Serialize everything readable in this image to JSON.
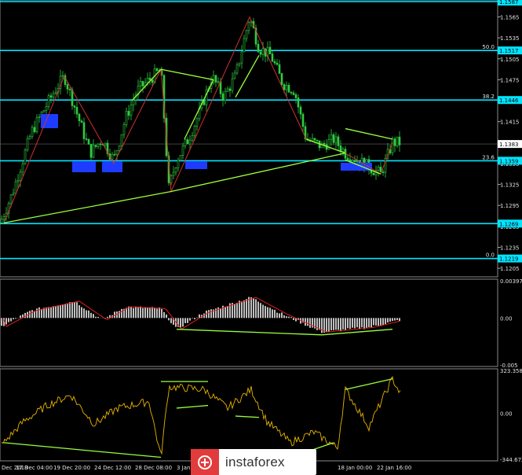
{
  "chart_data": {
    "type": "candlestick",
    "panels": [
      {
        "name": "price",
        "y_ticks": [
          "1.1565",
          "1.1535",
          "1.1505",
          "1.1475",
          "1.1445",
          "1.1415",
          "1.1383",
          "1.1355",
          "1.1325",
          "1.1295",
          "1.1265",
          "1.1235",
          "1.1205"
        ],
        "ylim": [
          1.1195,
          1.1587
        ],
        "fib_levels": [
          {
            "pct": "",
            "value": "1.1587",
            "color": "#00e5ff"
          },
          {
            "pct": "50.0",
            "value": "1.1517",
            "color": "#00e5ff"
          },
          {
            "pct": "38.2",
            "value": "1.1446",
            "color": "#00e5ff"
          },
          {
            "pct": "23.6",
            "value": "1.1359",
            "color": "#00e5ff"
          },
          {
            "pct": "",
            "value": "1.1269",
            "color": "#00e5ff"
          },
          {
            "pct": "0.0",
            "value": "1.1219",
            "color": "#00e5ff"
          }
        ],
        "current_price": "1.1383",
        "trend_color": "#9aff3c",
        "zigzag_color": "#d03030",
        "candle_color": "#2ecc40",
        "highlight_color": "#1e3cff"
      },
      {
        "name": "macd",
        "y_ticks": [
          "0.00397",
          "0.00",
          "-0.005"
        ],
        "ylim": [
          -0.005,
          0.00397
        ],
        "hist_color": "#bfbfbf",
        "signal_color": "#e02020"
      },
      {
        "name": "cci",
        "y_ticks": [
          "323.3582",
          "0.00",
          "-344.672"
        ],
        "ylim": [
          -344.672,
          323.3582
        ],
        "line_color": "#e8b400"
      }
    ],
    "x_ticks": [
      "Dec 2018",
      "17 Dec 04:00",
      "19 Dec 20:00",
      "24 Dec 12:00",
      "28 Dec 08:00",
      "3 Jan",
      "18 Jan 00:00",
      "22 Jan 16:00"
    ]
  },
  "logo": {
    "text": "instaforex"
  }
}
